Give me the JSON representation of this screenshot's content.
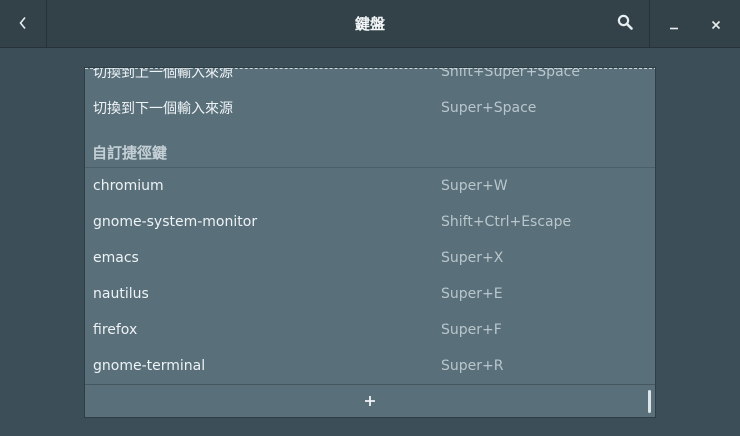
{
  "window": {
    "title": "鍵盤",
    "icons": {
      "back": "chevron-left-icon",
      "search": "search-icon",
      "minimize": "minimize-icon",
      "close": "close-icon"
    }
  },
  "shortcuts": {
    "input_source": [
      {
        "name": "切換到上一個輸入來源",
        "accel": "Shift+Super+Space"
      },
      {
        "name": "切換到下一個輸入來源",
        "accel": "Super+Space"
      }
    ],
    "custom_section_title": "自訂捷徑鍵",
    "custom": [
      {
        "name": "chromium",
        "accel": "Super+W"
      },
      {
        "name": "gnome-system-monitor",
        "accel": "Shift+Ctrl+Escape"
      },
      {
        "name": "emacs",
        "accel": "Super+X"
      },
      {
        "name": "nautilus",
        "accel": "Super+E"
      },
      {
        "name": "firefox",
        "accel": "Super+F"
      },
      {
        "name": "gnome-terminal",
        "accel": "Super+R"
      }
    ],
    "add_icon": "plus-icon"
  },
  "colors": {
    "headerbar": "#334249",
    "background": "#3c4e57",
    "list": "#596f7a"
  }
}
